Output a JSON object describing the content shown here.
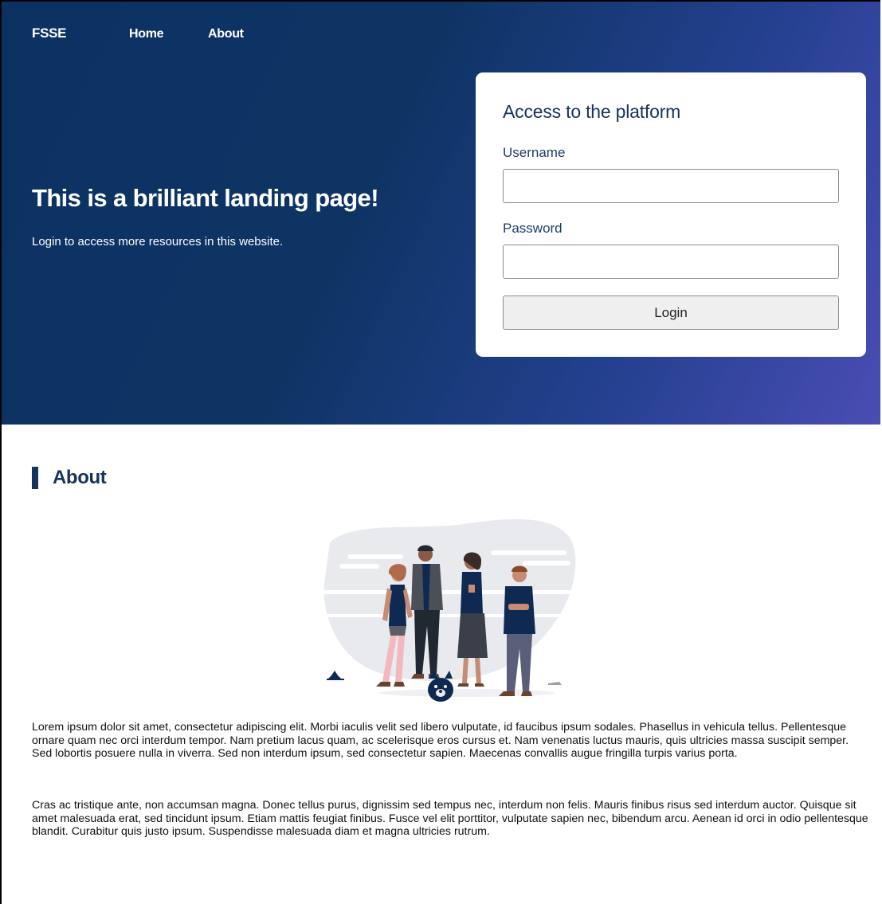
{
  "nav": {
    "brand": "FSSE",
    "links": [
      {
        "label": "Home"
      },
      {
        "label": "About"
      }
    ]
  },
  "hero": {
    "title": "This is a brilliant landing page!",
    "subtitle": "Login to access more resources in this website."
  },
  "login": {
    "title": "Access to the platform",
    "username_label": "Username",
    "username_value": "",
    "password_label": "Password",
    "password_value": "",
    "button_label": "Login"
  },
  "about": {
    "title": "About",
    "illustration": "group-of-people-with-dog-illustration",
    "paragraphs": [
      "Lorem ipsum dolor sit amet, consectetur adipiscing elit. Morbi iaculis velit sed libero vulputate, id faucibus ipsum sodales. Phasellus in vehicula tellus. Pellentesque ornare quam nec orci interdum tempor. Nam pretium lacus quam, ac scelerisque eros cursus et. Nam venenatis luctus mauris, quis ultricies massa suscipit semper. Sed lobortis posuere nulla in viverra. Sed non interdum ipsum, sed consectetur sapien. Maecenas convallis augue fringilla turpis varius porta.",
      "Cras ac tristique ante, non accumsan magna. Donec tellus purus, dignissim sed tempus nec, interdum non felis. Mauris finibus risus sed interdum auctor. Quisque sit amet malesuada erat, sed tincidunt ipsum. Etiam mattis feugiat finibus. Fusce vel elit porttitor, vulputate sapien nec, bibendum arcu. Aenean id orci in odio pellentesque blandit. Curabitur quis justo ipsum. Suspendisse malesuada diam et magna ultricies rutrum."
    ]
  },
  "colors": {
    "hero_start": "#0c3264",
    "hero_end": "#4a4db4",
    "accent": "#15335e"
  }
}
